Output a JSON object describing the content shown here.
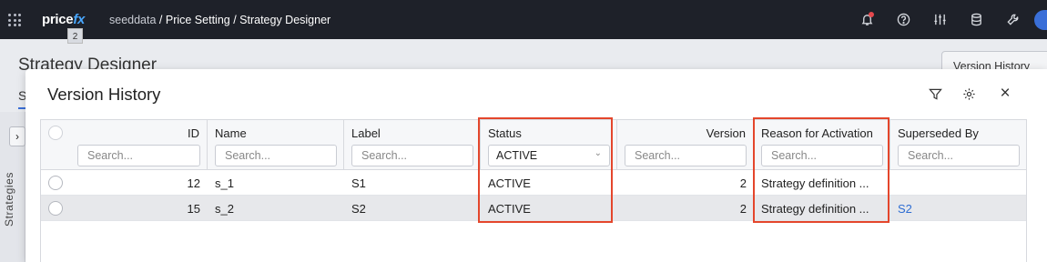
{
  "topbar": {
    "logo_price": "price",
    "logo_fx": "fx",
    "logo_badge": "2",
    "breadcrumb_env": "seeddata",
    "breadcrumb_sep": " / ",
    "breadcrumb_section": "Price Setting",
    "breadcrumb_page": "Strategy Designer",
    "icons": [
      "apps-grid-icon",
      "bell-icon",
      "help-icon",
      "sliders-icon",
      "database-icon",
      "wrench-icon",
      "avatar"
    ]
  },
  "background": {
    "page_title": "Strategy Designer",
    "version_history_button": "Version History",
    "tab_initial": "S",
    "sidebar_toggle": "›",
    "sidebar_label": "Strategies"
  },
  "dialog": {
    "title": "Version History",
    "icons": [
      "filter-icon",
      "settings-icon",
      "close-icon"
    ],
    "close_glyph": "×"
  },
  "grid": {
    "columns": [
      {
        "key": "id",
        "label": "ID",
        "placeholder": "Search..."
      },
      {
        "key": "name",
        "label": "Name",
        "placeholder": "Search..."
      },
      {
        "key": "label",
        "label": "Label",
        "placeholder": "Search..."
      },
      {
        "key": "status",
        "label": "Status",
        "filter_value": "ACTIVE"
      },
      {
        "key": "version",
        "label": "Version",
        "placeholder": "Search..."
      },
      {
        "key": "reason",
        "label": "Reason for Activation",
        "placeholder": "Search..."
      },
      {
        "key": "superseded",
        "label": "Superseded By",
        "placeholder": "Search..."
      }
    ],
    "rows": [
      {
        "id": "12",
        "name": "s_1",
        "label": "S1",
        "status": "ACTIVE",
        "version": "2",
        "reason": "Strategy definition ...",
        "superseded": ""
      },
      {
        "id": "15",
        "name": "s_2",
        "label": "S2",
        "status": "ACTIVE",
        "version": "2",
        "reason": "Strategy definition ...",
        "superseded": "S2"
      }
    ]
  },
  "colors": {
    "topbar_bg": "#1e2129",
    "accent": "#4aa8ff",
    "link": "#2f6ed3",
    "highlight": "#e4462c",
    "notification": "#e5484d"
  }
}
